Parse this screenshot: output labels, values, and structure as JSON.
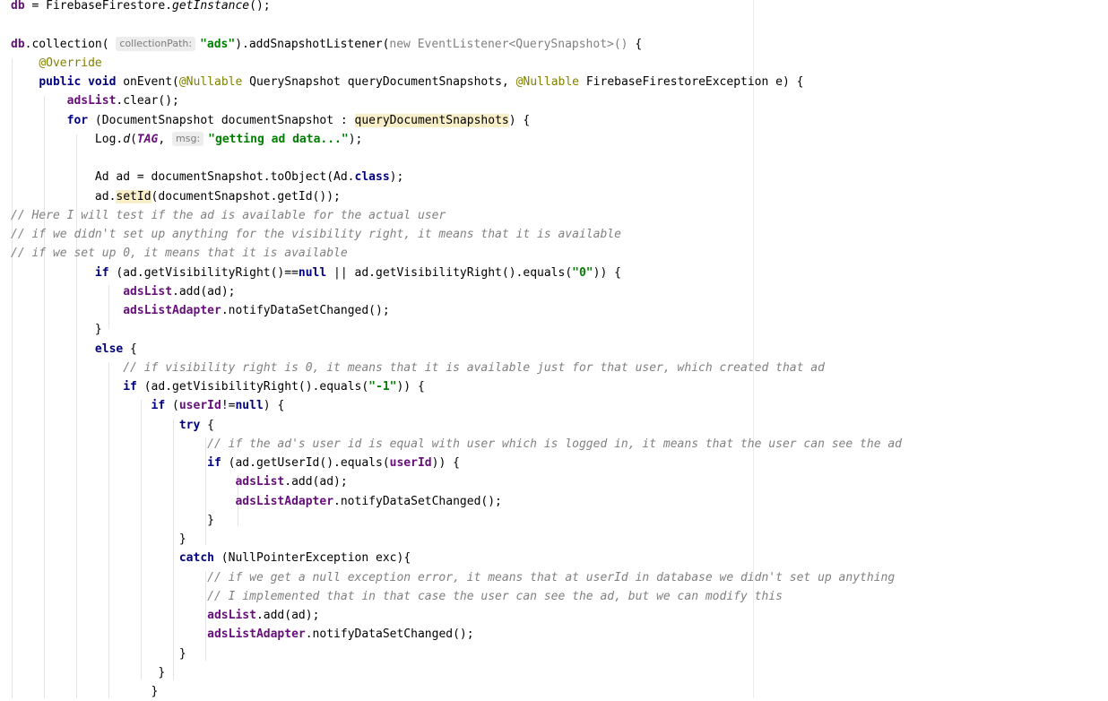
{
  "code": {
    "firestore_class": "FirebaseFirestore",
    "get_instance": "getInstance",
    "collection_hint": "collectionPath:",
    "collection_name": "\"ads\"",
    "event_listener_generic": "EventListener<QuerySnapshot>",
    "override_annotation": "@Override",
    "nullable_annotation": "@Nullable",
    "snapshot_param": "queryDocumentSnapshots",
    "exception_class": "FirebaseFirestoreException",
    "ads_list": "adsList",
    "ads_list_adapter": "adsListAdapter",
    "tag": "TAG",
    "msg_hint": "msg:",
    "log_message": "\"getting ad data...\"",
    "set_id": "setId",
    "zero_string": "\"0\"",
    "minus_one_string": "\"-1\"",
    "user_id": "userId",
    "exception_type": "NullPointerException",
    "comments": [
      "// Here I will test if the ad is available for the actual user",
      "// if we didn't set up anything for the visibility right, it means that it is available",
      "// if we set up 0, it means that it is available",
      "// if visibility right is 0, it means that it is available just for that user, which created that ad",
      "// if the ad's user id is equal with user which is logged in, it means that the user can see the ad",
      "// if we get a null exception error, it means that at userId in database we didn't set up anything",
      "// I implemented that in that case the user can see the ad, but we can modify this"
    ]
  }
}
